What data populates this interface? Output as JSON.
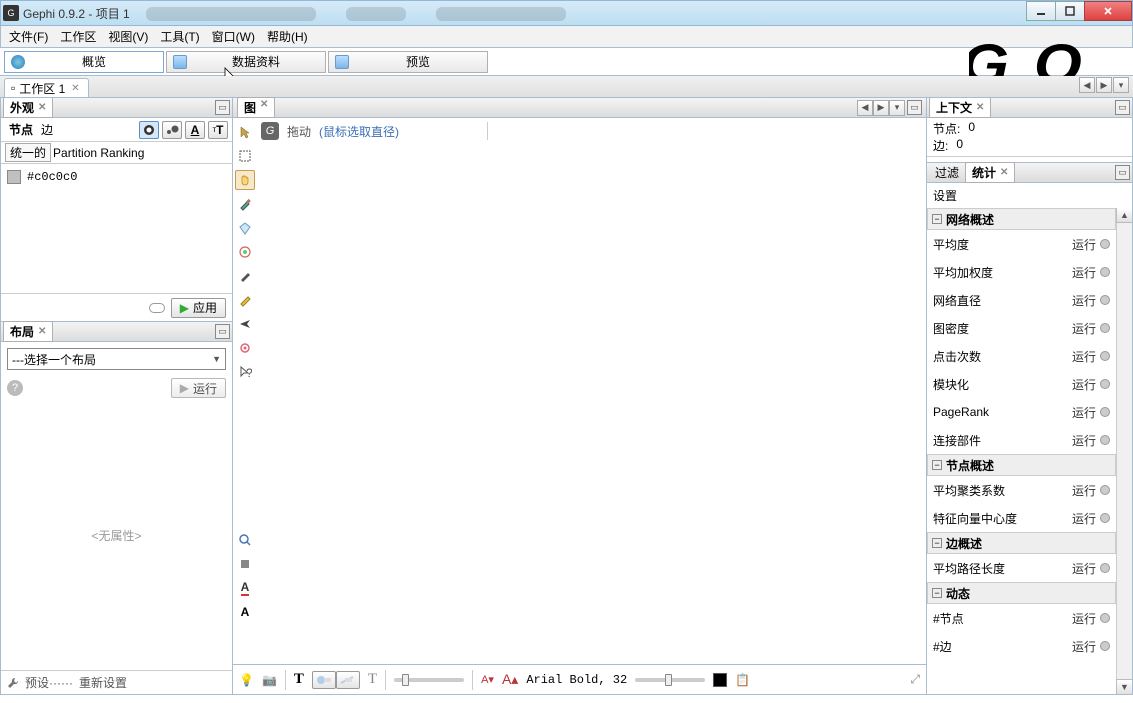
{
  "window": {
    "title": "Gephi 0.9.2 - 项目 1"
  },
  "menu": {
    "file": "文件(F)",
    "workspace": "工作区",
    "view": "视图(V)",
    "tools": "工具(T)",
    "window": "窗口(W)",
    "help": "帮助(H)"
  },
  "ptabs": {
    "overview": "概览",
    "datalab": "数据资料",
    "preview": "预览"
  },
  "workspace": {
    "tab": "工作区 1"
  },
  "appearance": {
    "title": "外观",
    "nodes": "节点",
    "edges": "边",
    "unified": "统一的",
    "partition_ranking": "Partition Ranking",
    "color_hex": "#c0c0c0",
    "apply": "应用"
  },
  "layout": {
    "title": "布局",
    "select_placeholder": "---选择一个布局",
    "run": "运行",
    "no_props": "<无属性>",
    "presets": "预设······",
    "reset": "重新设置"
  },
  "graph": {
    "title": "图",
    "drag": "拖动",
    "hint": "(鼠标选取直径)",
    "font": "Arial Bold, 32"
  },
  "context": {
    "title": "上下文",
    "nodes_label": "节点:",
    "nodes_val": "0",
    "edges_label": "边:",
    "edges_val": "0"
  },
  "filter_stats": {
    "filter": "过滤",
    "stats": "统计",
    "settings": "设置",
    "cat_network": "网络概述",
    "cat_node": "节点概述",
    "cat_edge": "边概述",
    "cat_dynamic": "动态",
    "run": "运行",
    "items_network": [
      "平均度",
      "平均加权度",
      "网络直径",
      "图密度",
      "点击次数",
      "模块化",
      "PageRank",
      "连接部件"
    ],
    "items_node": [
      "平均聚类系数",
      "特征向量中心度"
    ],
    "items_edge": [
      "平均路径长度"
    ],
    "items_dyn": [
      "#节点",
      "#边"
    ]
  }
}
